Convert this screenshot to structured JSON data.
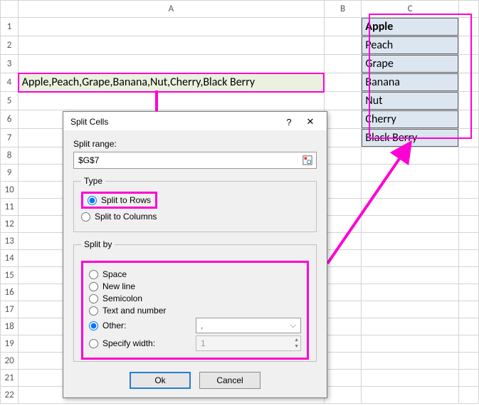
{
  "sheet": {
    "columns": [
      "A",
      "B",
      "C"
    ],
    "rows_count": 22,
    "a4_value": "Apple,Peach,Grape,Banana,Nut,Cherry,Black Berry",
    "results": [
      "Apple",
      "Peach",
      "Grape",
      "Banana",
      "Nut",
      "Cherry",
      "Black Berry"
    ]
  },
  "dialog": {
    "title": "Split Cells",
    "help_glyph": "?",
    "close_glyph": "✕",
    "range_label": "Split range:",
    "range_value": "$G$7",
    "type": {
      "legend": "Type",
      "rows_label": "Split to Rows",
      "cols_label": "Split to Columns"
    },
    "splitby": {
      "legend": "Split by",
      "space": "Space",
      "newline": "New line",
      "semicolon": "Semicolon",
      "textnum": "Text and number",
      "other": "Other:",
      "other_value": ",",
      "width": "Specify width:",
      "width_value": "1"
    },
    "ok_label": "Ok",
    "cancel_label": "Cancel"
  }
}
